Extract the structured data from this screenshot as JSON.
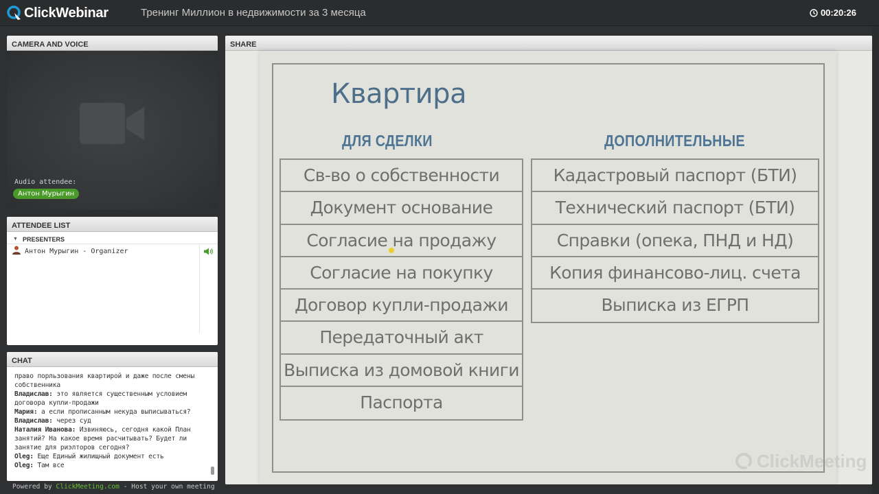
{
  "topbar": {
    "logo_text": "ClickWebinar",
    "title": "Тренинг Миллион в недвижимости за 3 месяца",
    "timer": "00:20:26"
  },
  "camera": {
    "header": "CAMERA AND VOICE",
    "audio_label": "Audio attendee:",
    "audio_name": "Антон Мурыгин"
  },
  "attendees": {
    "header": "ATTENDEE LIST",
    "section": "PRESENTERS",
    "items": [
      {
        "name": "Антон Мурыгин - Organizer"
      }
    ]
  },
  "chat": {
    "header": "CHAT",
    "messages": [
      {
        "author": "",
        "text": "право порльзования квартирой и даже после смены"
      },
      {
        "author": "",
        "text": "собственника"
      },
      {
        "author": "Владислав:",
        "text": " это является существенным условием"
      },
      {
        "author": "",
        "text": "договора купли-продажи"
      },
      {
        "author": "Мария:",
        "text": " а если прописанным некуда выписываться?"
      },
      {
        "author": "Владислав:",
        "text": " через суд"
      },
      {
        "author": "Наталия Иванова:",
        "text": " Извиняюсь, сегодня какой План"
      },
      {
        "author": "",
        "text": "занятий? На какое время расчитывать? Будет ли"
      },
      {
        "author": "",
        "text": "занятие для риэлторов сегодня?"
      },
      {
        "author": "Oleg:",
        "text": " Еще Единый жилищный документ есть"
      },
      {
        "author": "Oleg:",
        "text": " Там все"
      }
    ]
  },
  "footer": {
    "prefix": "Powered by ",
    "link": "ClickMeeting.com",
    "suffix": " - Host your own meeting"
  },
  "share": {
    "header": "SHARE",
    "slide": {
      "title": "Квартира",
      "left_heading": "ДЛЯ СДЕЛКИ",
      "right_heading": "ДОПОЛНИТЕЛЬНЫЕ",
      "left_items": [
        "Св-во о собственности",
        "Документ основание",
        "Согласие на продажу",
        "Согласие на покупку",
        "Договор купли-продажи",
        "Передаточный акт",
        "Выписка из домовой книги",
        "Паспорта"
      ],
      "right_items": [
        "Кадастровый паспорт (БТИ)",
        "Технический паспорт (БТИ)",
        "Справки (опека, ПНД и НД)",
        "Копия финансово-лиц. счета",
        "Выписка из ЕГРП"
      ]
    },
    "watermark": "ClickMeeting"
  },
  "colors": {
    "accent_green": "#4a9a2a",
    "logo_blue": "#1e9ad6",
    "slide_title": "#4d6f8a"
  }
}
